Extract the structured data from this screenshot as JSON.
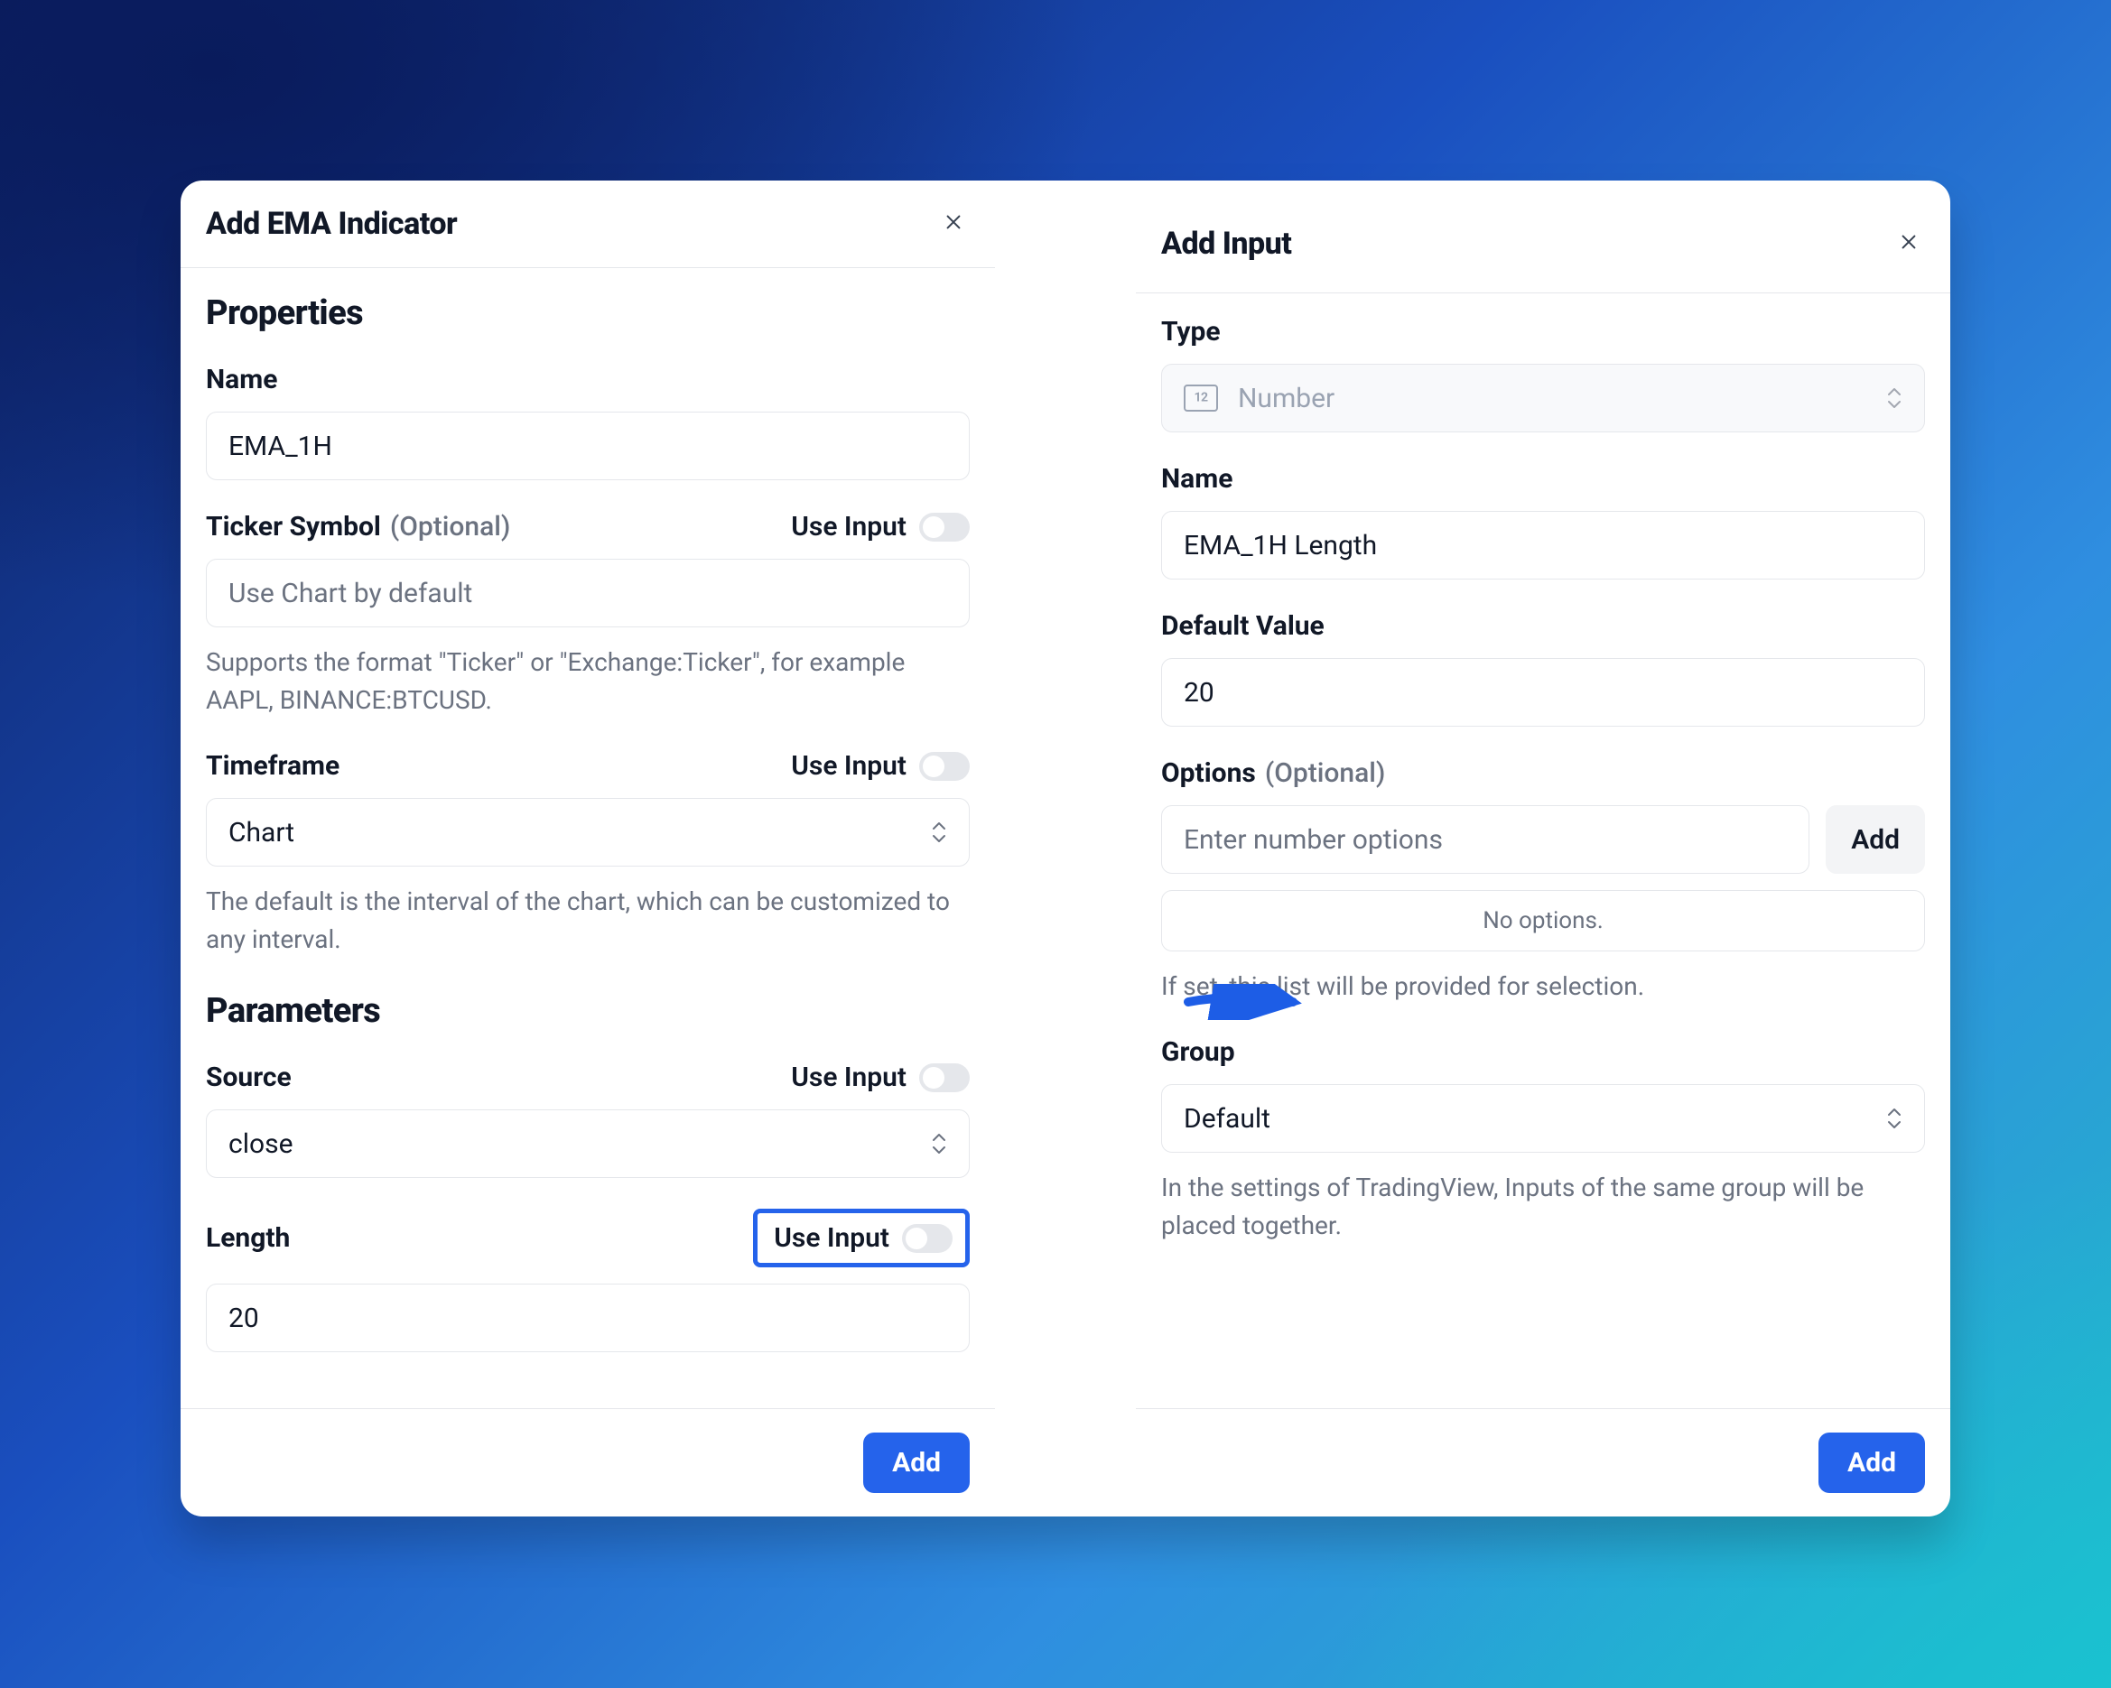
{
  "left": {
    "title": "Add EMA Indicator",
    "sections": {
      "properties": {
        "heading": "Properties",
        "name": {
          "label": "Name",
          "value": "EMA_1H"
        },
        "ticker": {
          "label": "Ticker Symbol",
          "optional": "(Optional)",
          "use_input_label": "Use Input",
          "placeholder": "Use Chart by default",
          "help": "Supports the format \"Ticker\" or \"Exchange:Ticker\", for example AAPL, BINANCE:BTCUSD."
        },
        "timeframe": {
          "label": "Timeframe",
          "use_input_label": "Use Input",
          "value": "Chart",
          "help": "The default is the interval of the chart, which can be customized to any interval."
        }
      },
      "parameters": {
        "heading": "Parameters",
        "source": {
          "label": "Source",
          "use_input_label": "Use Input",
          "value": "close"
        },
        "length": {
          "label": "Length",
          "use_input_label": "Use Input",
          "value": "20"
        }
      }
    },
    "footer": {
      "add_label": "Add"
    }
  },
  "right": {
    "title": "Add Input",
    "type": {
      "label": "Type",
      "value": "Number"
    },
    "name": {
      "label": "Name",
      "value": "EMA_1H Length"
    },
    "default_value": {
      "label": "Default Value",
      "value": "20"
    },
    "options": {
      "label": "Options",
      "optional": "(Optional)",
      "placeholder": "Enter number options",
      "add_label": "Add",
      "empty_text": "No options.",
      "help": "If set, this list will be provided for selection."
    },
    "group": {
      "label": "Group",
      "value": "Default",
      "help": "In the settings of TradingView, Inputs of the same group will be placed together."
    },
    "footer": {
      "add_label": "Add"
    }
  }
}
